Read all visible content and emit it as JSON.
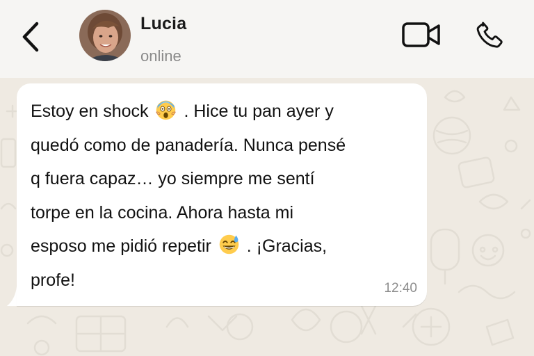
{
  "header": {
    "contact_name": "Lucia",
    "status": "online"
  },
  "message": {
    "lines": [
      {
        "before": "Estoy en shock",
        "emoji": "face-screaming-in-fear",
        "after": ". Hice tu pan ayer y"
      },
      {
        "before": "quedó como de panadería. Nunca pensé",
        "emoji": "",
        "after": ""
      },
      {
        "before": "q fuera capaz… yo siempre me sentí",
        "emoji": "",
        "after": ""
      },
      {
        "before": "torpe en la cocina. Ahora hasta mi",
        "emoji": "",
        "after": ""
      },
      {
        "before": "esposo me pidió repetir",
        "emoji": "grinning-face-with-sweat",
        "after": ". ¡Gracias,"
      },
      {
        "before": "profe!",
        "emoji": "",
        "after": ""
      }
    ],
    "time": "12:40"
  },
  "colors": {
    "background": "#efeae2",
    "header": "#f6f5f3",
    "bubble": "#ffffff",
    "secondary_text": "#8a8a8a"
  },
  "icons": {
    "back": "chevron-left-icon",
    "video": "video-camera-icon",
    "call": "phone-icon"
  }
}
